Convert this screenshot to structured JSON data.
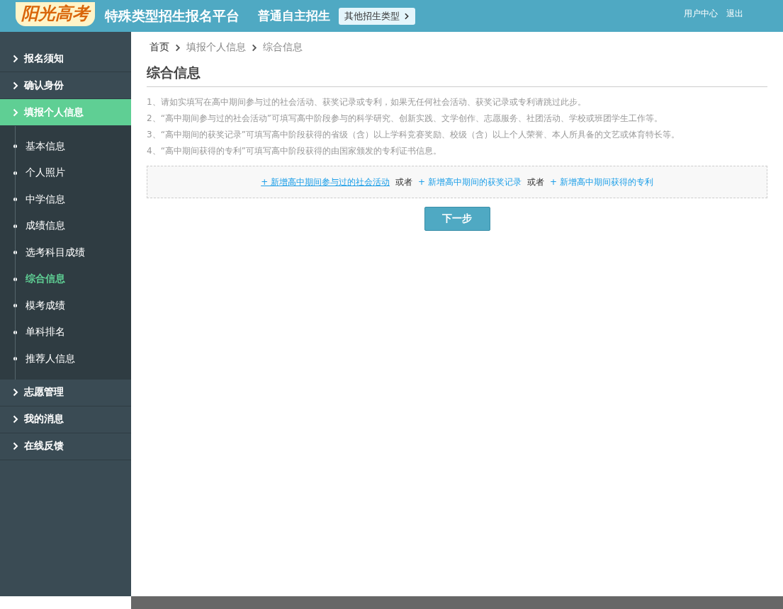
{
  "header": {
    "logo": "阳光高考",
    "title": "特殊类型招生报名平台",
    "category": "普通自主招生",
    "switch_button": "其他招生类型",
    "links": [
      "用户中心",
      "退出"
    ]
  },
  "sidebar": {
    "items": [
      {
        "label": "报名须知",
        "selected": false
      },
      {
        "label": "确认身份",
        "selected": false
      },
      {
        "label": "填报个人信息",
        "selected": true,
        "children": [
          {
            "label": "基本信息",
            "selected": false
          },
          {
            "label": "个人照片",
            "selected": false
          },
          {
            "label": "中学信息",
            "selected": false
          },
          {
            "label": "成绩信息",
            "selected": false
          },
          {
            "label": "选考科目成绩",
            "selected": false
          },
          {
            "label": "综合信息",
            "selected": true
          },
          {
            "label": "模考成绩",
            "selected": false
          },
          {
            "label": "单科排名",
            "selected": false
          },
          {
            "label": "推荐人信息",
            "selected": false
          }
        ]
      },
      {
        "label": "志愿管理",
        "selected": false
      },
      {
        "label": "我的消息",
        "selected": false
      },
      {
        "label": "在线反馈",
        "selected": false
      }
    ]
  },
  "breadcrumb": [
    "首页",
    "填报个人信息",
    "综合信息"
  ],
  "page_title": "综合信息",
  "instructions": [
    "1、请如实填写在高中期间参与过的社会活动、获奖记录或专利，如果无任何社会活动、获奖记录或专利请跳过此步。",
    "2、“高中期间参与过的社会活动”可填写高中阶段参与的科学研究、创新实践、文学创作、志愿服务、社团活动、学校或班团学生工作等。",
    "3、“高中期间的获奖记录”可填写高中阶段获得的省级（含）以上学科竞赛奖励、校级（含）以上个人荣誉、本人所具备的文艺或体育特长等。",
    "4、“高中期间获得的专利”可填写高中阶段获得的由国家颁发的专利证书信息。"
  ],
  "add_links": [
    {
      "kind": "link",
      "text": "+ 新增高中期间参与过的社会活动",
      "hovered": true
    },
    {
      "kind": "separator",
      "text": "或者"
    },
    {
      "kind": "link",
      "text": "+ 新增高中期间的获奖记录",
      "hovered": false
    },
    {
      "kind": "separator",
      "text": "或者"
    },
    {
      "kind": "link",
      "text": "+ 新增高中期间获得的专利",
      "hovered": false
    }
  ],
  "next_button": "下一步"
}
